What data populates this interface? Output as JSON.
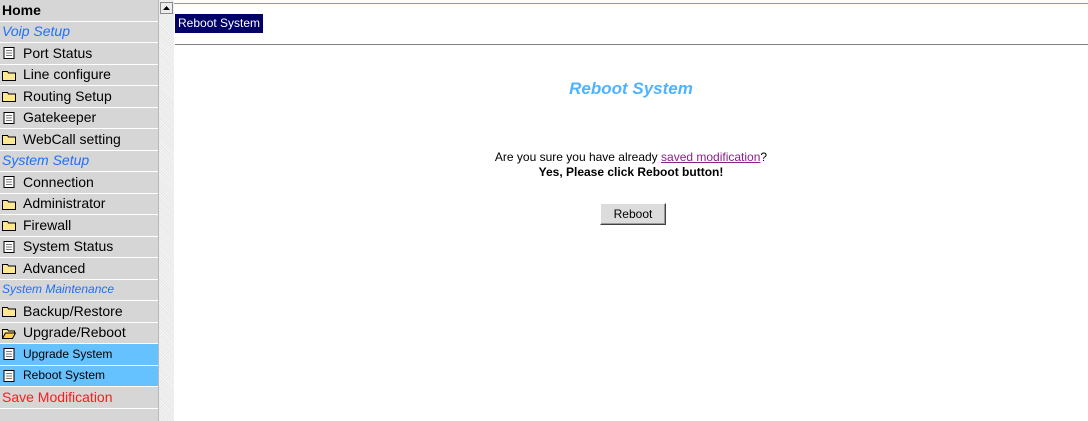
{
  "sidebar": {
    "home": "Home",
    "voip_section": "Voip Setup",
    "voip_items": [
      "Port Status",
      "Line configure",
      "Routing Setup",
      "Gatekeeper",
      "WebCall setting"
    ],
    "system_section": "System Setup",
    "system_items": [
      "Connection",
      "Administrator",
      "Firewall",
      "System Status",
      "Advanced"
    ],
    "maintenance_section": "System Maintenance",
    "maintenance_items": [
      "Backup/Restore",
      "Upgrade/Reboot"
    ],
    "sub_items": [
      "Upgrade System",
      "Reboot System"
    ],
    "save": "Save Modification"
  },
  "page": {
    "tab_title": "Reboot System",
    "heading": "Reboot System",
    "question_prefix": "Are you sure you have already ",
    "question_link": "saved modification",
    "question_suffix": "?",
    "instruction": "Yes, Please click Reboot button!",
    "button": "Reboot"
  },
  "colors": {
    "sidebar_bg": "#d6d6d6",
    "section_text": "#1e6fff",
    "highlight_bg": "#66c2ff",
    "save_text": "#ff1a1a",
    "heading_text": "#4fb3ff",
    "tab_bg": "#000066"
  }
}
